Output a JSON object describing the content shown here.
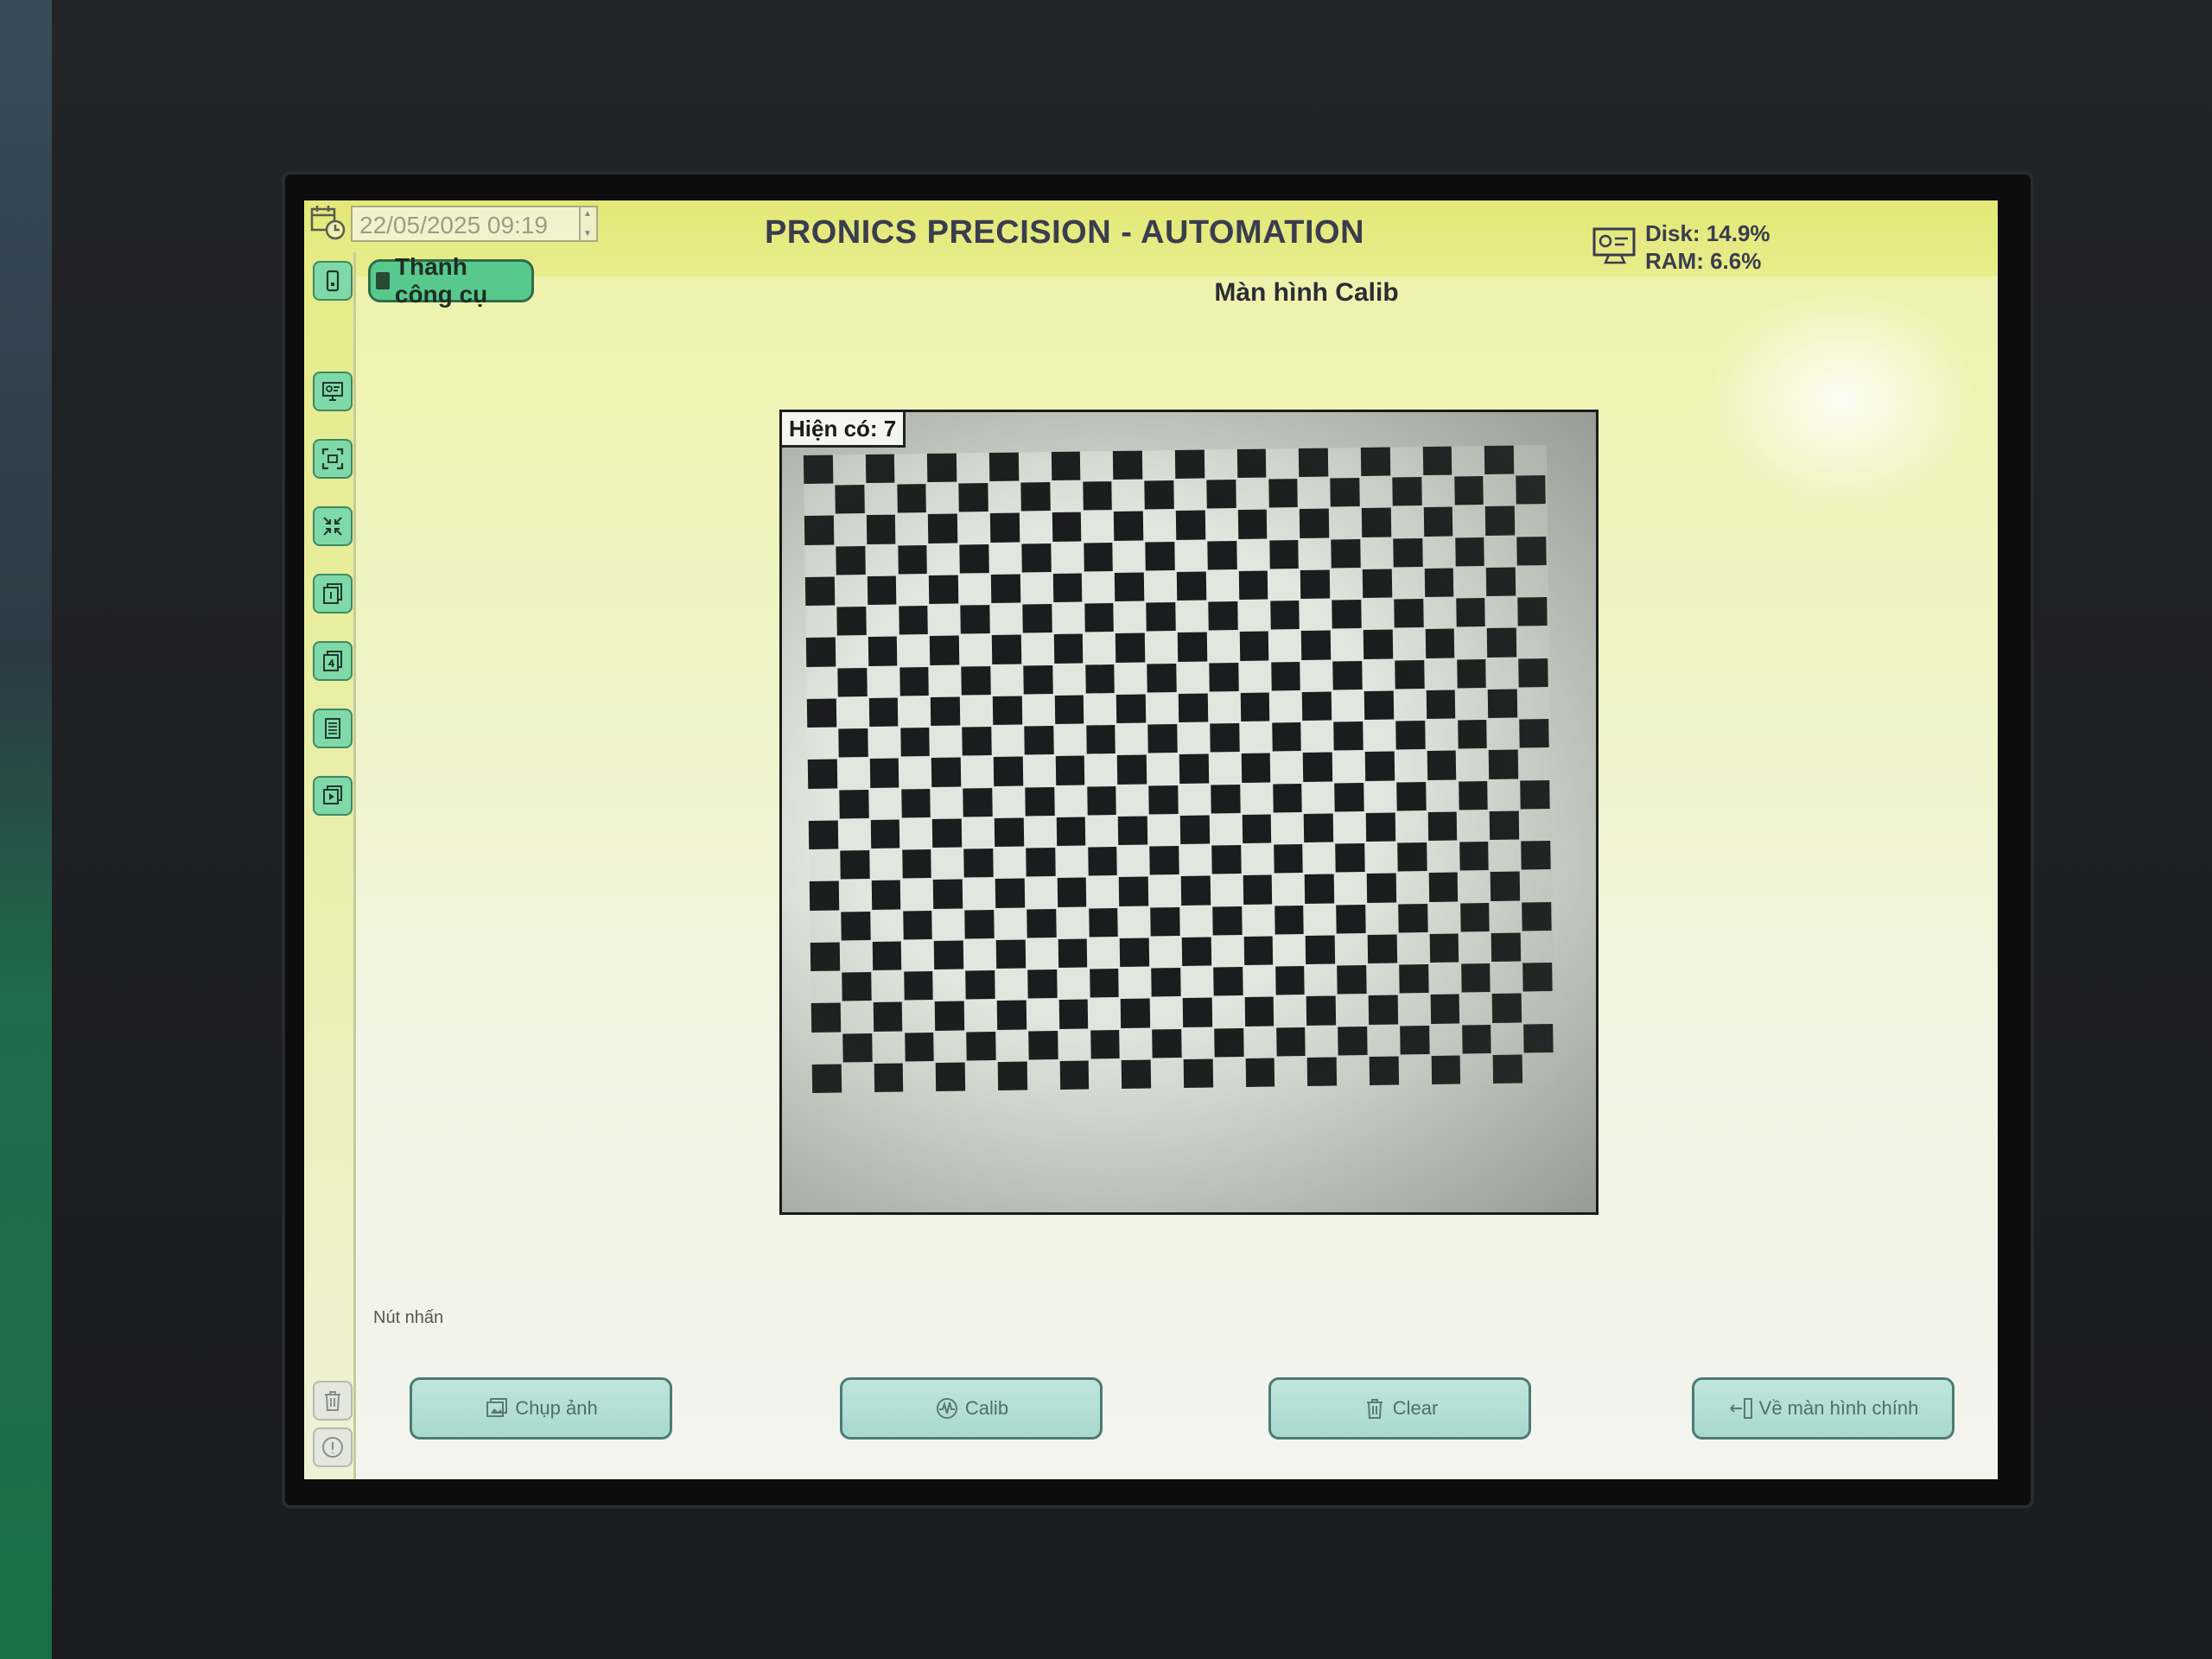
{
  "header": {
    "datetime": "22/05/2025 09:19",
    "app_title": "PRONICS PRECISION - AUTOMATION",
    "disk": "Disk: 14.9%",
    "ram": "RAM: 6.6%"
  },
  "toolbar": {
    "toggle_label": "Thanh công cụ"
  },
  "screen": {
    "title": "Màn hình Calib"
  },
  "camera": {
    "count_label": "Hiện có: 7"
  },
  "actions": {
    "group_label": "Nút nhấn",
    "capture_label": "Chụp ảnh",
    "calib_label": "Calib",
    "clear_label": "Clear",
    "home_label": "Về màn hình chính"
  },
  "icons": {
    "calendar": "calendar-clock-icon",
    "monitor": "monitor-icon",
    "sidebar": [
      "mobile-icon",
      "monitor-icon",
      "capture-frame-icon",
      "compress-icon",
      "page-1-icon",
      "page-4-icon",
      "list-icon",
      "image-icon",
      "trash-icon",
      "info-icon",
      "crosshair-icon"
    ]
  },
  "colors": {
    "accent_green": "#58c98c",
    "button_teal": "#a8d8cf",
    "header_yellow": "#e3e876"
  }
}
